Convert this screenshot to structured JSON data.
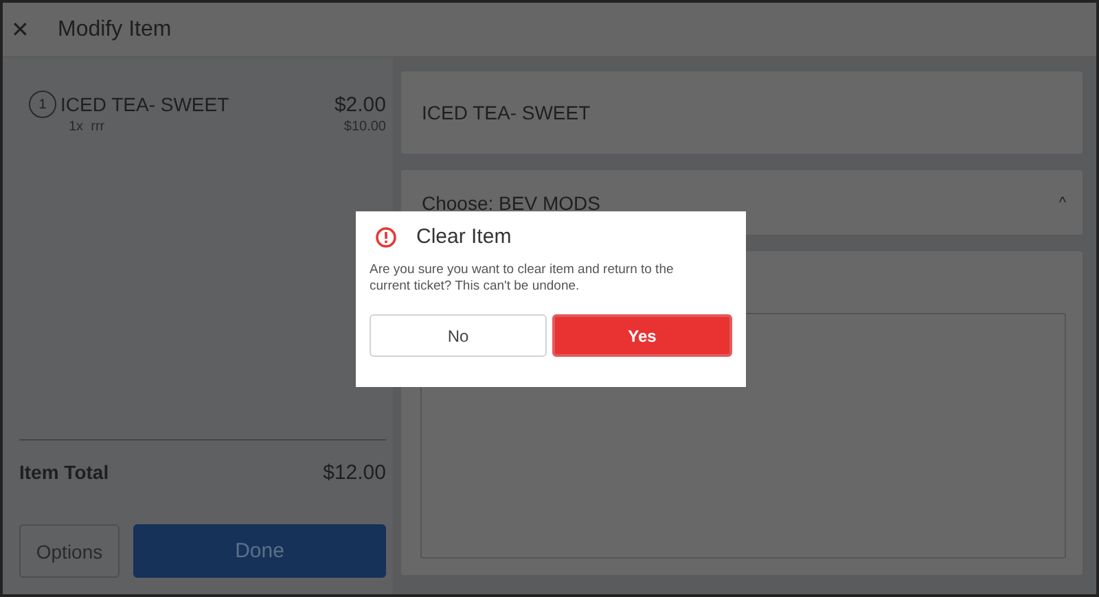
{
  "header": {
    "close": "✕",
    "title": "Modify Item"
  },
  "order_item": {
    "quantity": "1",
    "name": "ICED TEA- SWEET",
    "price": "$2.00",
    "modifier": "1x  rrr",
    "modifier_price": "$10.00"
  },
  "total": {
    "label": "Item Total",
    "value": "$12.00"
  },
  "actions": [
    {
      "label": "Options",
      "kind": "secondary"
    },
    {
      "label": "Done",
      "kind": "primary"
    }
  ],
  "item_card": {
    "title": "ICED TEA- SWEET"
  },
  "modifier_group": {
    "title": "Choose: BEV MODS",
    "caret": "^",
    "expanded": true
  },
  "dialog": {
    "title": "Clear Item",
    "message": "Are you sure you want to clear item and return to the current ticket? This can't be undone.",
    "buttons": [
      {
        "label": "No",
        "kind": "secondary"
      },
      {
        "label": "Yes",
        "kind": "primary"
      }
    ]
  }
}
